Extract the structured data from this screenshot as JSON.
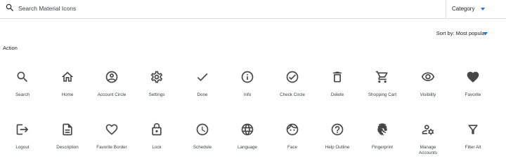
{
  "search": {
    "placeholder": "Search Material Icons",
    "value": ""
  },
  "category": {
    "label": "Category"
  },
  "sort": {
    "label": "Sort by: Most popular"
  },
  "section": {
    "title": "Action"
  },
  "colors": {
    "accent": "#1a73e8",
    "icon": "#474747",
    "divider": "#e0e0e0"
  },
  "icons": [
    {
      "label": "Search",
      "icon": "search-icon"
    },
    {
      "label": "Home",
      "icon": "home-icon"
    },
    {
      "label": "Account Circle",
      "icon": "account-circle-icon"
    },
    {
      "label": "Settings",
      "icon": "settings-icon"
    },
    {
      "label": "Done",
      "icon": "done-icon"
    },
    {
      "label": "Info",
      "icon": "info-icon"
    },
    {
      "label": "Check Circle",
      "icon": "check-circle-icon"
    },
    {
      "label": "Delete",
      "icon": "delete-icon"
    },
    {
      "label": "Shopping Cart",
      "icon": "shopping-cart-icon"
    },
    {
      "label": "Visibility",
      "icon": "visibility-icon"
    },
    {
      "label": "Favorite",
      "icon": "favorite-icon"
    },
    {
      "label": "Logout",
      "icon": "logout-icon"
    },
    {
      "label": "Description",
      "icon": "description-icon"
    },
    {
      "label": "Favorite Border",
      "icon": "favorite-border-icon"
    },
    {
      "label": "Lock",
      "icon": "lock-icon"
    },
    {
      "label": "Schedule",
      "icon": "schedule-icon"
    },
    {
      "label": "Language",
      "icon": "language-icon"
    },
    {
      "label": "Face",
      "icon": "face-icon"
    },
    {
      "label": "Help Outline",
      "icon": "help-outline-icon"
    },
    {
      "label": "Fingerprint",
      "icon": "fingerprint-icon"
    },
    {
      "label": "Manage Accounts",
      "icon": "manage-accounts-icon"
    },
    {
      "label": "Filter Alt",
      "icon": "filter-alt-icon"
    }
  ]
}
